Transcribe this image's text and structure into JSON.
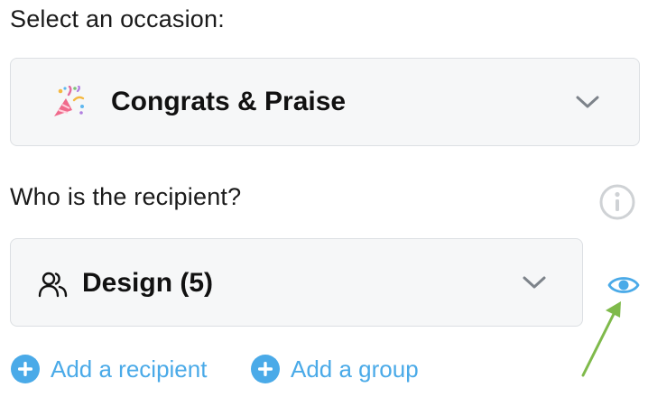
{
  "occasion": {
    "label": "Select an occasion:",
    "selected": "Congrats & Praise",
    "icon": "party-popper-icon"
  },
  "recipient": {
    "label": "Who is the recipient?",
    "selected": "Design (5)",
    "icon": "users-icon",
    "info_icon": "info-icon",
    "preview_icon": "eye-icon"
  },
  "actions": {
    "add_recipient": "Add a recipient",
    "add_group": "Add a group"
  },
  "colors": {
    "accent": "#4aaae8",
    "field_bg": "#f6f7f8",
    "field_border": "#dcdfe3",
    "chevron": "#7d838a",
    "info_icon": "#cfd2d5",
    "annotation_arrow": "#7fba4b"
  }
}
